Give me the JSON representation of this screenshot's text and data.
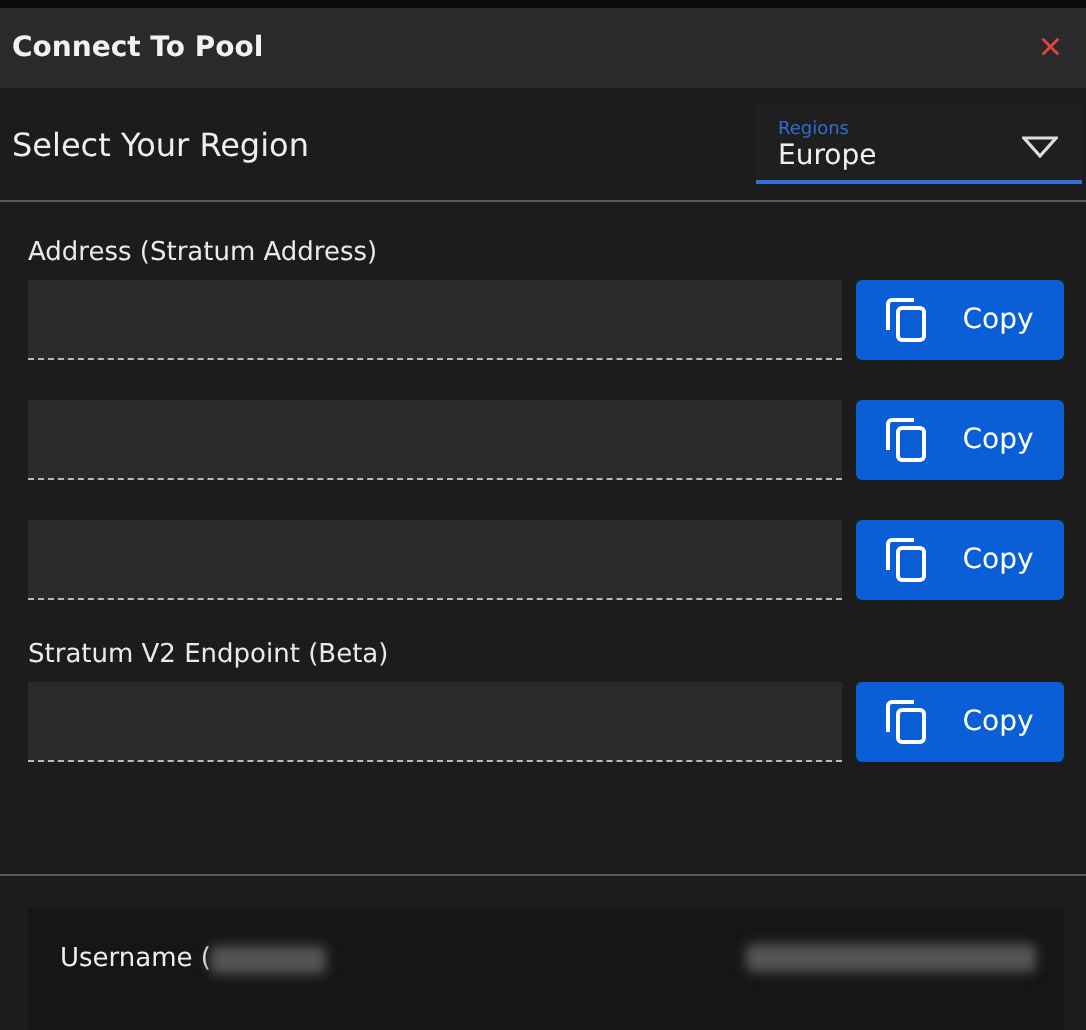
{
  "window": {
    "title": "Connect To Pool",
    "close": "×"
  },
  "region": {
    "label": "Select Your Region",
    "select_label": "Regions",
    "value": "Europe"
  },
  "sections": [
    {
      "label": "Address (Stratum Address)",
      "fields": [
        {
          "button": "Copy"
        },
        {
          "button": "Copy"
        },
        {
          "button": "Copy"
        }
      ]
    },
    {
      "label": "Stratum V2 Endpoint (Beta)",
      "fields": [
        {
          "button": "Copy"
        }
      ]
    }
  ],
  "username": {
    "label": "Username ("
  }
}
